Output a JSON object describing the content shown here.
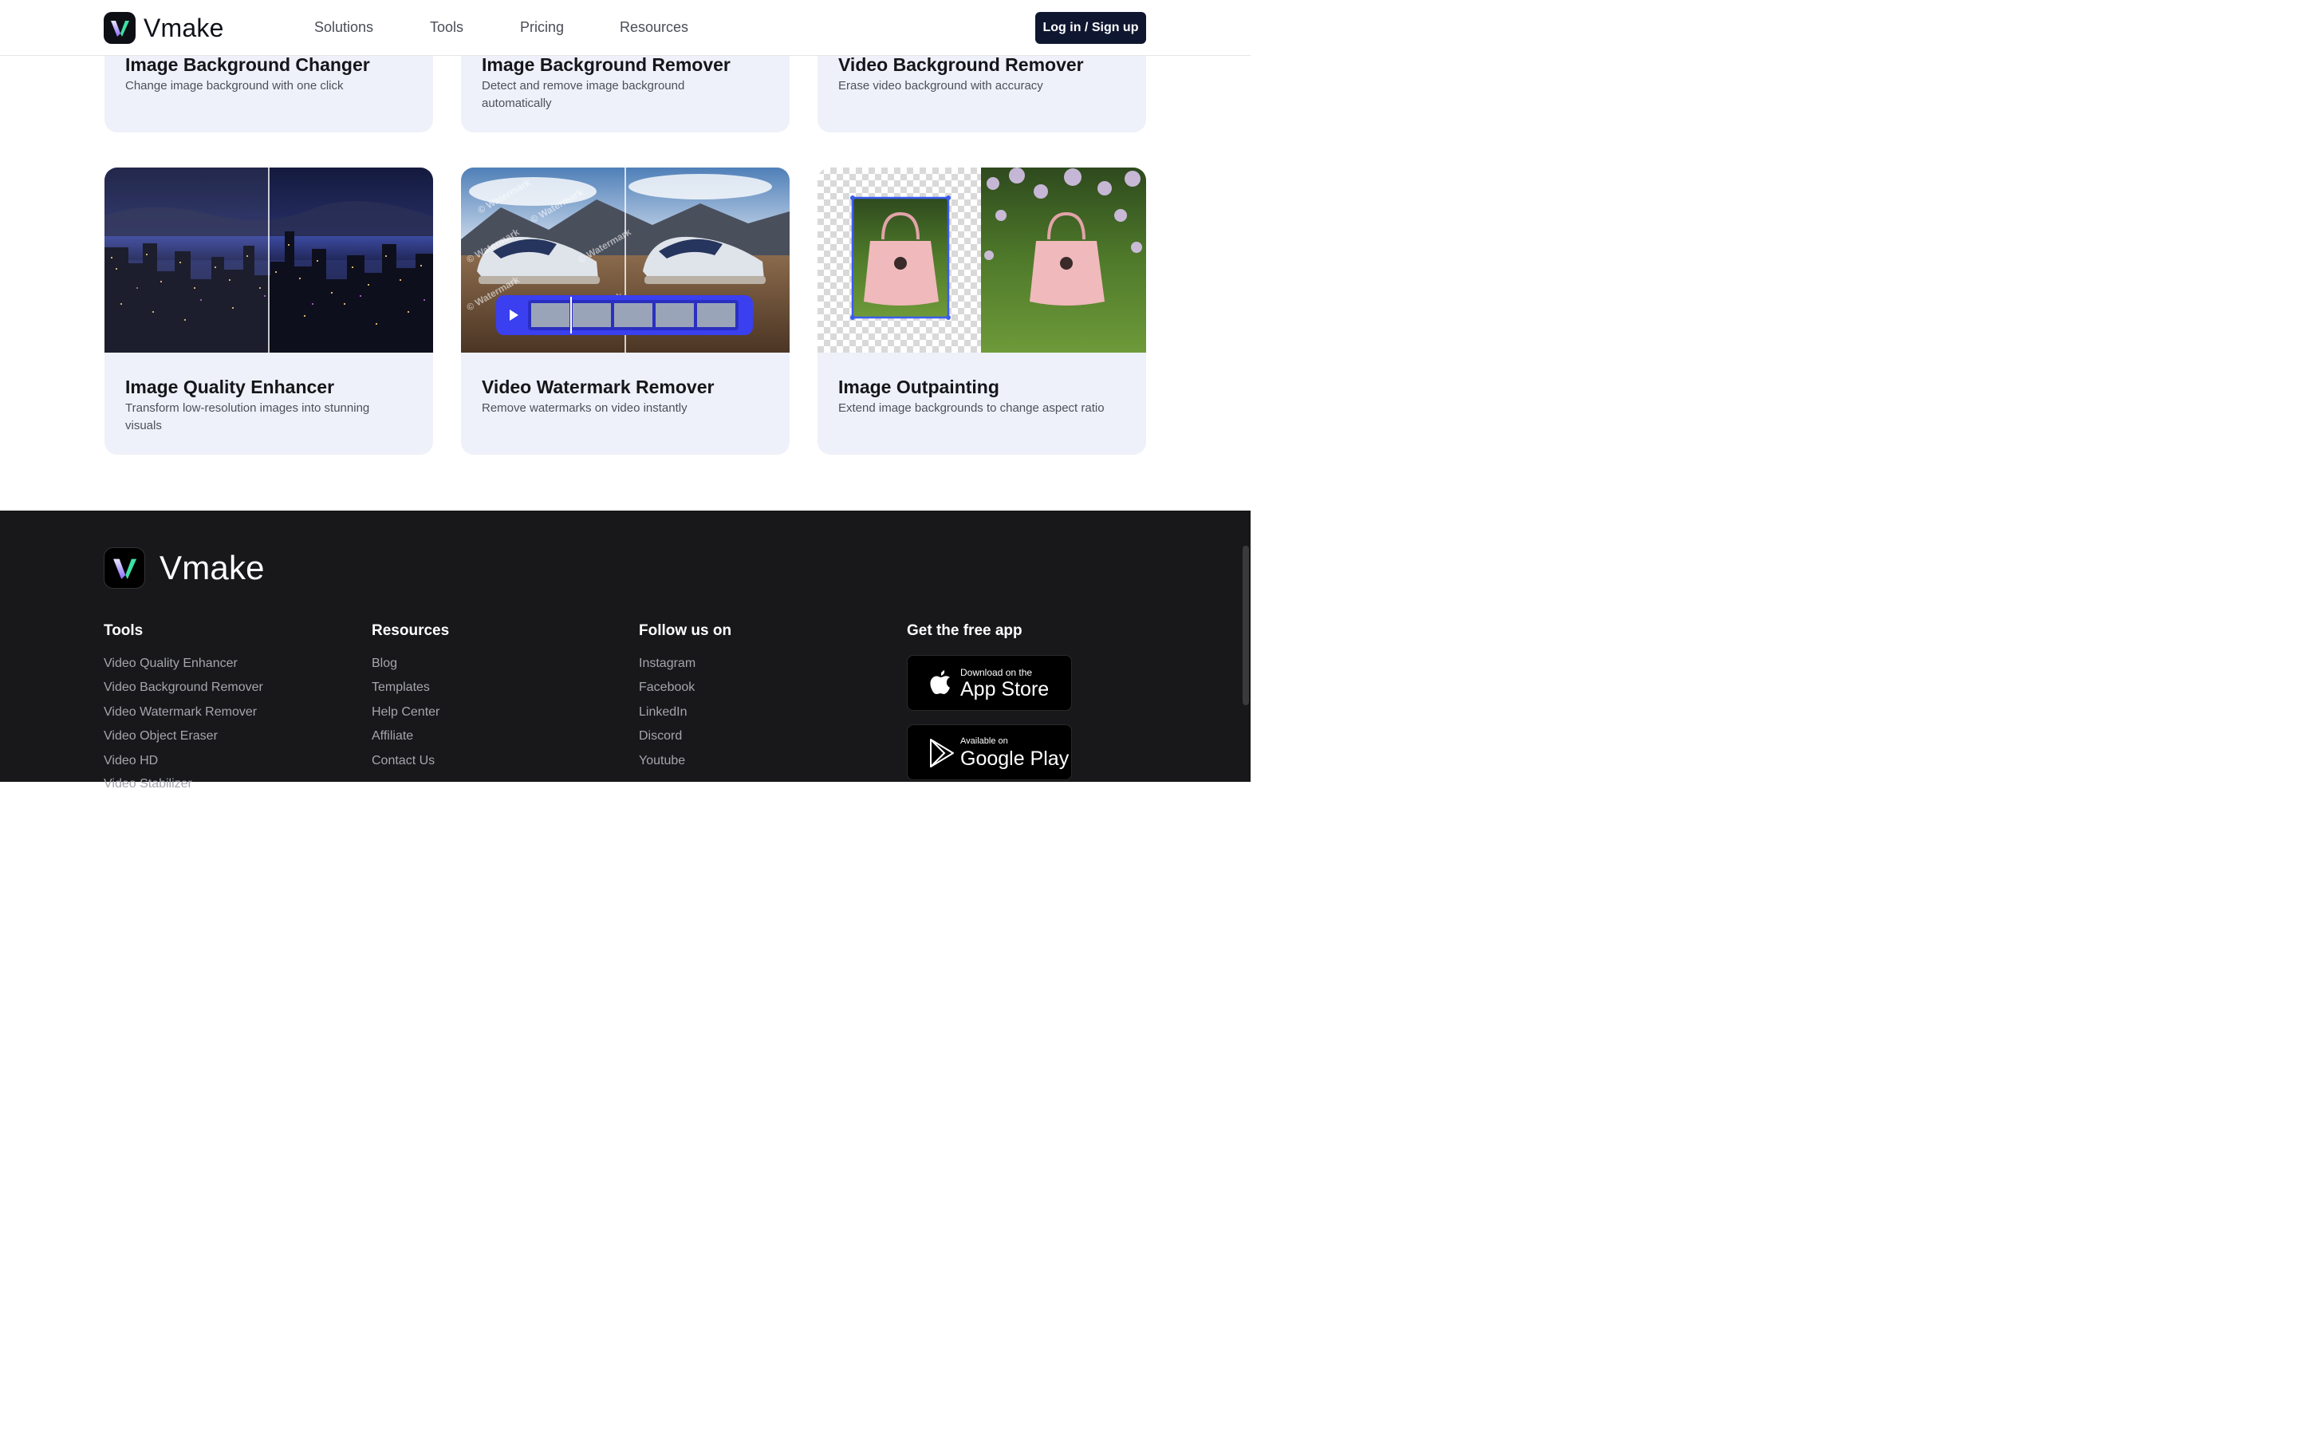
{
  "header": {
    "brand": "Vmake",
    "nav": [
      "Solutions",
      "Tools",
      "Pricing",
      "Resources"
    ],
    "login_label": "Log in / Sign up"
  },
  "cards_top": [
    {
      "title": "Image Background Changer",
      "desc": "Change image background with one click"
    },
    {
      "title": "Image Background Remover",
      "desc": "Detect and remove image background automatically"
    },
    {
      "title": "Video Background Remover",
      "desc": "Erase video background with accuracy"
    }
  ],
  "cards_bottom": [
    {
      "title": "Image Quality Enhancer",
      "desc": "Transform low-resolution images into stunning visuals"
    },
    {
      "title": "Video Watermark Remover",
      "desc": "Remove watermarks on video instantly",
      "watermark_text": "© Watermark"
    },
    {
      "title": "Image Outpainting",
      "desc": "Extend image backgrounds to change aspect ratio"
    }
  ],
  "footer": {
    "brand": "Vmake",
    "columns": [
      {
        "heading": "Tools",
        "links": [
          "Video Quality Enhancer",
          "Video Background Remover",
          "Video Watermark Remover",
          "Video Object Eraser",
          "Video HD",
          "Video Stabilizer"
        ]
      },
      {
        "heading": "Resources",
        "links": [
          "Blog",
          "Templates",
          "Help Center",
          "Affiliate",
          "Contact Us"
        ]
      },
      {
        "heading": "Follow us on",
        "links": [
          "Instagram",
          "Facebook",
          "LinkedIn",
          "Discord",
          "Youtube"
        ]
      },
      {
        "heading": "Get the free app",
        "links": []
      }
    ],
    "app_store": {
      "small": "Download on the",
      "big": "App Store"
    },
    "google_play": {
      "small": "Available on",
      "big": "Google Play"
    }
  },
  "colors": {
    "brand_dark": "#0f1730",
    "card_bg": "#eef1f9",
    "footer_bg": "#18181a",
    "accent_blue": "#3a3ff0",
    "logo_green": "#3fe0a6",
    "logo_purple": "#8a6cff"
  }
}
